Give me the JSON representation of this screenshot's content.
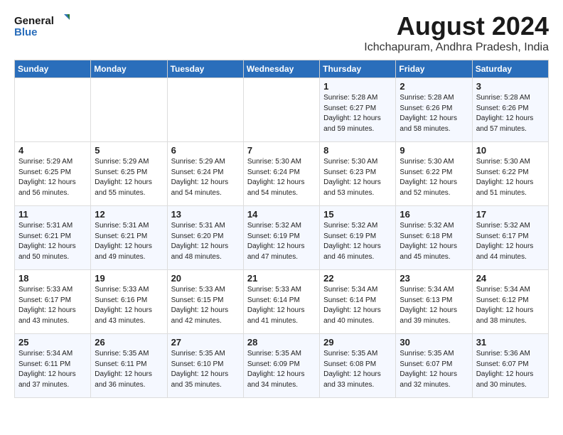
{
  "logo": {
    "line1": "General",
    "line2": "Blue"
  },
  "title": "August 2024",
  "subtitle": "Ichchapuram, Andhra Pradesh, India",
  "days_of_week": [
    "Sunday",
    "Monday",
    "Tuesday",
    "Wednesday",
    "Thursday",
    "Friday",
    "Saturday"
  ],
  "weeks": [
    [
      {
        "day": "",
        "info": ""
      },
      {
        "day": "",
        "info": ""
      },
      {
        "day": "",
        "info": ""
      },
      {
        "day": "",
        "info": ""
      },
      {
        "day": "1",
        "info": "Sunrise: 5:28 AM\nSunset: 6:27 PM\nDaylight: 12 hours\nand 59 minutes."
      },
      {
        "day": "2",
        "info": "Sunrise: 5:28 AM\nSunset: 6:26 PM\nDaylight: 12 hours\nand 58 minutes."
      },
      {
        "day": "3",
        "info": "Sunrise: 5:28 AM\nSunset: 6:26 PM\nDaylight: 12 hours\nand 57 minutes."
      }
    ],
    [
      {
        "day": "4",
        "info": "Sunrise: 5:29 AM\nSunset: 6:25 PM\nDaylight: 12 hours\nand 56 minutes."
      },
      {
        "day": "5",
        "info": "Sunrise: 5:29 AM\nSunset: 6:25 PM\nDaylight: 12 hours\nand 55 minutes."
      },
      {
        "day": "6",
        "info": "Sunrise: 5:29 AM\nSunset: 6:24 PM\nDaylight: 12 hours\nand 54 minutes."
      },
      {
        "day": "7",
        "info": "Sunrise: 5:30 AM\nSunset: 6:24 PM\nDaylight: 12 hours\nand 54 minutes."
      },
      {
        "day": "8",
        "info": "Sunrise: 5:30 AM\nSunset: 6:23 PM\nDaylight: 12 hours\nand 53 minutes."
      },
      {
        "day": "9",
        "info": "Sunrise: 5:30 AM\nSunset: 6:22 PM\nDaylight: 12 hours\nand 52 minutes."
      },
      {
        "day": "10",
        "info": "Sunrise: 5:30 AM\nSunset: 6:22 PM\nDaylight: 12 hours\nand 51 minutes."
      }
    ],
    [
      {
        "day": "11",
        "info": "Sunrise: 5:31 AM\nSunset: 6:21 PM\nDaylight: 12 hours\nand 50 minutes."
      },
      {
        "day": "12",
        "info": "Sunrise: 5:31 AM\nSunset: 6:21 PM\nDaylight: 12 hours\nand 49 minutes."
      },
      {
        "day": "13",
        "info": "Sunrise: 5:31 AM\nSunset: 6:20 PM\nDaylight: 12 hours\nand 48 minutes."
      },
      {
        "day": "14",
        "info": "Sunrise: 5:32 AM\nSunset: 6:19 PM\nDaylight: 12 hours\nand 47 minutes."
      },
      {
        "day": "15",
        "info": "Sunrise: 5:32 AM\nSunset: 6:19 PM\nDaylight: 12 hours\nand 46 minutes."
      },
      {
        "day": "16",
        "info": "Sunrise: 5:32 AM\nSunset: 6:18 PM\nDaylight: 12 hours\nand 45 minutes."
      },
      {
        "day": "17",
        "info": "Sunrise: 5:32 AM\nSunset: 6:17 PM\nDaylight: 12 hours\nand 44 minutes."
      }
    ],
    [
      {
        "day": "18",
        "info": "Sunrise: 5:33 AM\nSunset: 6:17 PM\nDaylight: 12 hours\nand 43 minutes."
      },
      {
        "day": "19",
        "info": "Sunrise: 5:33 AM\nSunset: 6:16 PM\nDaylight: 12 hours\nand 43 minutes."
      },
      {
        "day": "20",
        "info": "Sunrise: 5:33 AM\nSunset: 6:15 PM\nDaylight: 12 hours\nand 42 minutes."
      },
      {
        "day": "21",
        "info": "Sunrise: 5:33 AM\nSunset: 6:14 PM\nDaylight: 12 hours\nand 41 minutes."
      },
      {
        "day": "22",
        "info": "Sunrise: 5:34 AM\nSunset: 6:14 PM\nDaylight: 12 hours\nand 40 minutes."
      },
      {
        "day": "23",
        "info": "Sunrise: 5:34 AM\nSunset: 6:13 PM\nDaylight: 12 hours\nand 39 minutes."
      },
      {
        "day": "24",
        "info": "Sunrise: 5:34 AM\nSunset: 6:12 PM\nDaylight: 12 hours\nand 38 minutes."
      }
    ],
    [
      {
        "day": "25",
        "info": "Sunrise: 5:34 AM\nSunset: 6:11 PM\nDaylight: 12 hours\nand 37 minutes."
      },
      {
        "day": "26",
        "info": "Sunrise: 5:35 AM\nSunset: 6:11 PM\nDaylight: 12 hours\nand 36 minutes."
      },
      {
        "day": "27",
        "info": "Sunrise: 5:35 AM\nSunset: 6:10 PM\nDaylight: 12 hours\nand 35 minutes."
      },
      {
        "day": "28",
        "info": "Sunrise: 5:35 AM\nSunset: 6:09 PM\nDaylight: 12 hours\nand 34 minutes."
      },
      {
        "day": "29",
        "info": "Sunrise: 5:35 AM\nSunset: 6:08 PM\nDaylight: 12 hours\nand 33 minutes."
      },
      {
        "day": "30",
        "info": "Sunrise: 5:35 AM\nSunset: 6:07 PM\nDaylight: 12 hours\nand 32 minutes."
      },
      {
        "day": "31",
        "info": "Sunrise: 5:36 AM\nSunset: 6:07 PM\nDaylight: 12 hours\nand 30 minutes."
      }
    ]
  ]
}
